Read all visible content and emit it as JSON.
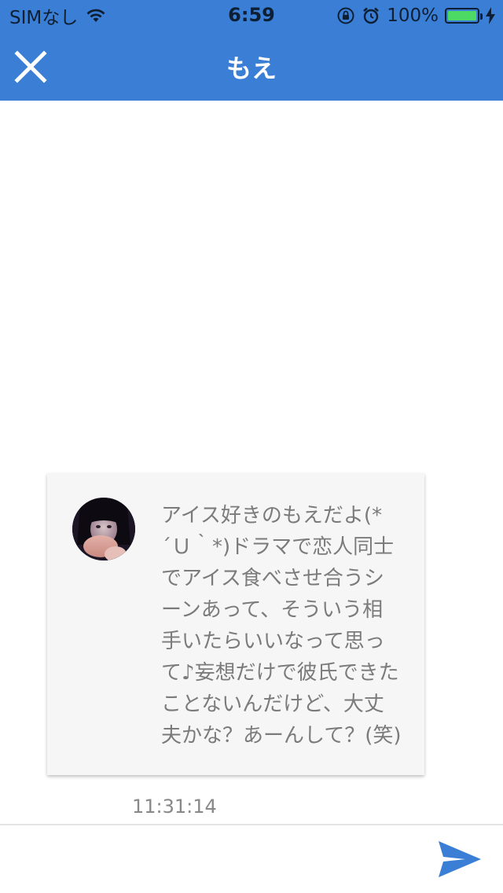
{
  "status_bar": {
    "carrier": "SIMなし",
    "time": "6:59",
    "battery_percent": "100%",
    "battery_level": 1.0,
    "icons": [
      "wifi-icon",
      "rotation-lock-icon",
      "alarm-icon",
      "battery-icon",
      "charging-icon"
    ]
  },
  "nav": {
    "title": "もえ",
    "close_icon": "close-icon"
  },
  "message": {
    "text": "アイス好きのもえだよ(*\n´Ｕ｀*)ドラマで恋人同士\nでアイス食べさせ合うシ\nーンあって、そういう相\n手いたらいいなって思っ\nて♪妄想だけで彼氏できた\nことないんだけど、大丈\n夫かな？あーんして？(笑)",
    "timestamp": "11:31:14"
  },
  "composer": {
    "value": "",
    "send_icon": "send-icon"
  },
  "colors": {
    "accent": "#3a7fd5",
    "card_bg": "#f6f6f6",
    "message_text": "#7b7b7b",
    "battery": "#4cd964"
  }
}
